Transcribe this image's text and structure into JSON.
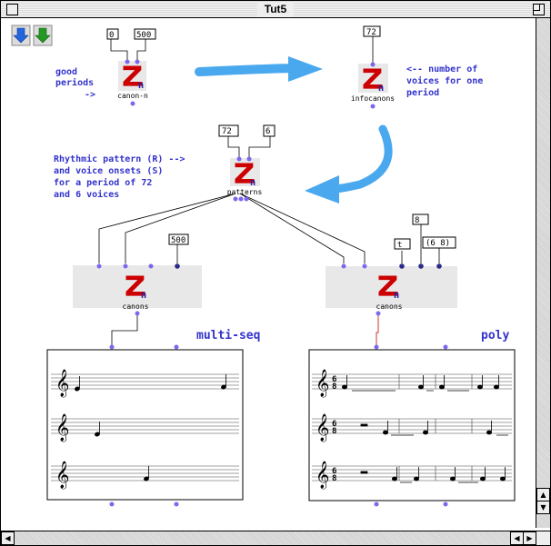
{
  "window": {
    "title": "Tut5"
  },
  "comments": {
    "good_periods": [
      "good",
      "periods",
      "->"
    ],
    "voices": [
      "<-- number of",
      "voices for one",
      "period"
    ],
    "rhythmic": [
      "Rhythmic pattern (R)  -->",
      "and voice onsets (S)",
      "for a period of 72",
      "and 6 voices"
    ]
  },
  "boxes": {
    "canon_n": {
      "label": "canon-n",
      "in1": "0",
      "in2": "500"
    },
    "infocanons": {
      "label": "infocanons",
      "in1": "72"
    },
    "patterns": {
      "label": "patterns",
      "in1": "72",
      "in2": "6"
    },
    "canons_left": {
      "label": "canons",
      "in_extra": "500"
    },
    "canons_right": {
      "label": "canons",
      "in_t": "t",
      "in_8": "8",
      "in_list": "(6 8)"
    }
  },
  "editors": {
    "multi_seq": "multi-seq",
    "poly": "poly"
  },
  "icons": {
    "logo": "Zn",
    "down_blue": "blue-down-arrow",
    "down_green": "green-down-arrow"
  },
  "scrollbar": {
    "up": "▲",
    "down": "▼",
    "left": "◀",
    "right": "▶"
  },
  "colors": {
    "accent": "#3333cc",
    "logo_red": "#cc0000",
    "arrow_blue": "#4aa8ee",
    "inlet": "#7b68ee",
    "outlet": "#2a2a8a"
  }
}
